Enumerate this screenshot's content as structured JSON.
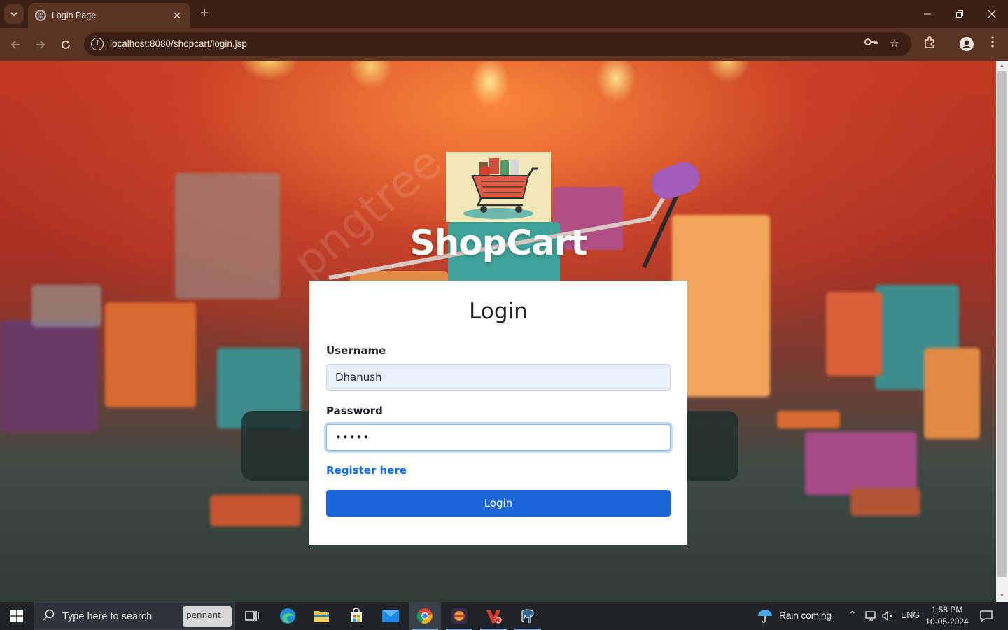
{
  "browser": {
    "tab_title": "Login Page",
    "url": "localhost:8080/shopcart/login.jsp"
  },
  "page": {
    "brand": "ShopCart",
    "login_title": "Login",
    "username_label": "Username",
    "username_value": "Dhanush",
    "password_label": "Password",
    "password_masked": "•••••",
    "register_link": "Register here",
    "login_button": "Login",
    "watermark": "pngtree"
  },
  "taskbar": {
    "search_placeholder": "Type here to search",
    "search_widget": "pennant",
    "weather": "Rain coming",
    "language": "ENG",
    "time": "1:58 PM",
    "date": "10-05-2024"
  },
  "colors": {
    "primary": "#1a66d6",
    "link": "#0d6efd",
    "autofill": "#e8f0fe"
  }
}
